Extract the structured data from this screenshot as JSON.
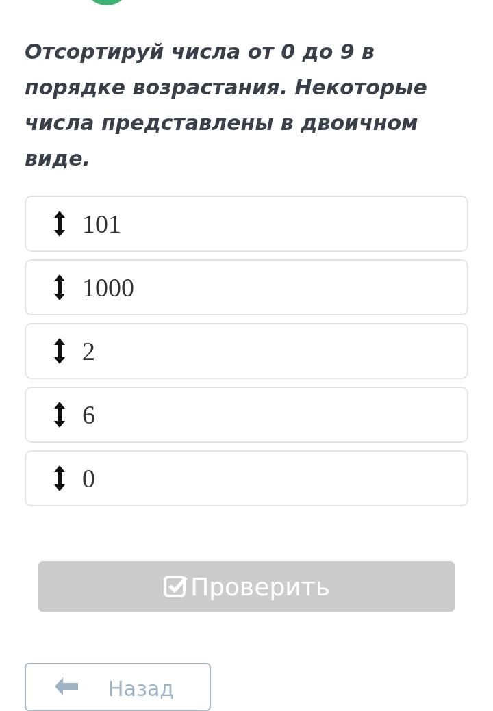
{
  "question": "Отсортируй числа от 0 до 9 в порядке возрастания. Некоторые числа представлены в двоичном виде.",
  "items": [
    {
      "label": "101"
    },
    {
      "label": "1000"
    },
    {
      "label": "2"
    },
    {
      "label": "6"
    },
    {
      "label": "0"
    }
  ],
  "check_button": {
    "label": "Проверить",
    "disabled": true
  },
  "back_button": {
    "label": "Назад"
  }
}
